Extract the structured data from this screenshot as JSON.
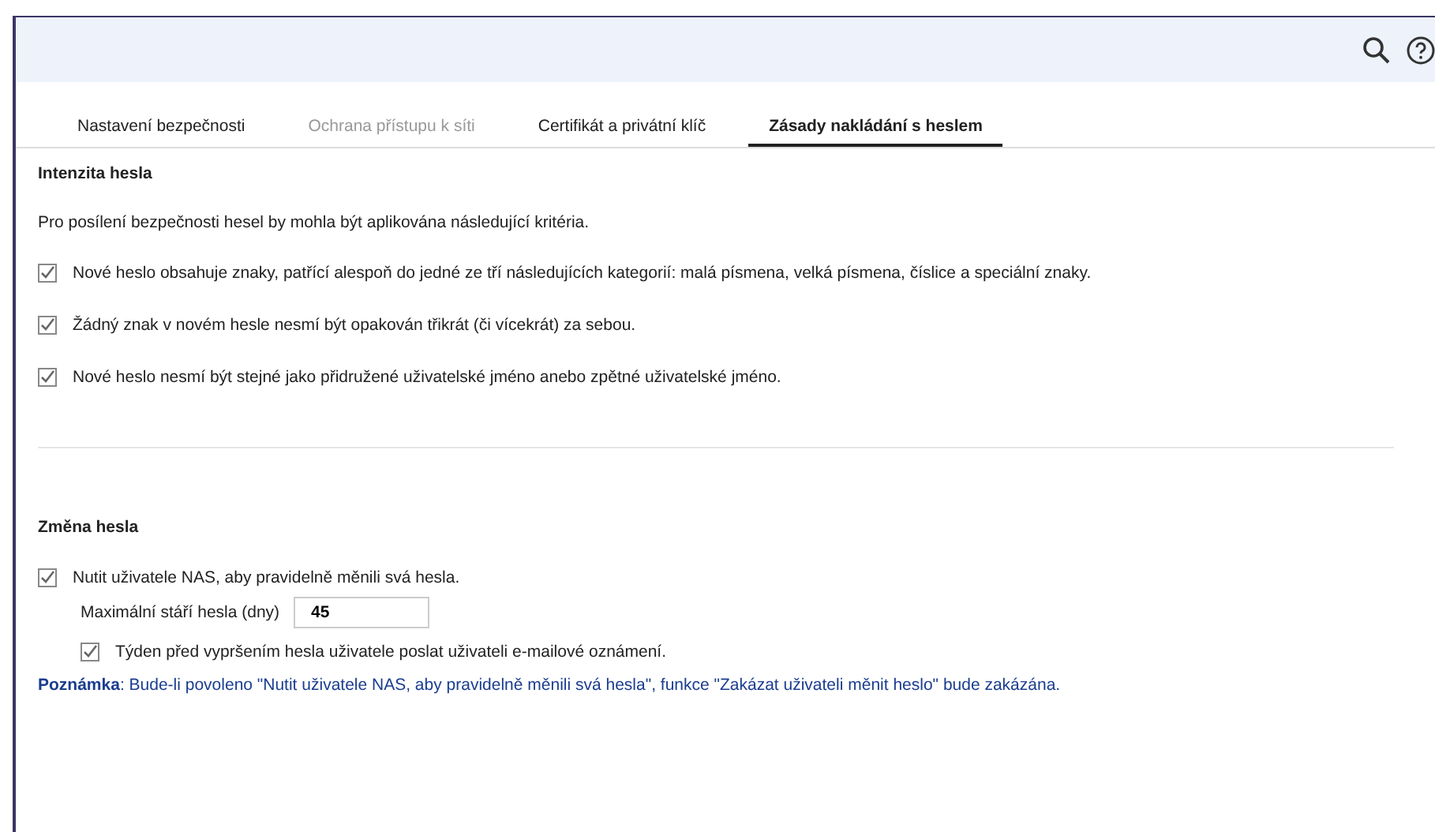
{
  "tabs": [
    {
      "label": "Nastavení bezpečnosti",
      "selected": false,
      "disabled": false
    },
    {
      "label": "Ochrana přístupu k síti",
      "selected": false,
      "disabled": true
    },
    {
      "label": "Certifikát a privátní klíč",
      "selected": false,
      "disabled": false
    },
    {
      "label": "Zásady nakládání s heslem",
      "selected": true,
      "disabled": false
    }
  ],
  "strength": {
    "title": "Intenzita hesla",
    "intro": "Pro posílení bezpečnosti hesel by mohla být aplikována následující kritéria.",
    "options": [
      {
        "label": "Nové heslo obsahuje znaky, patřící alespoň do jedné ze tří následujících kategorií: malá písmena, velká písmena, číslice a speciální znaky.",
        "checked": true
      },
      {
        "label": "Žádný znak v novém hesle nesmí být opakován třikrát (či vícekrát) za sebou.",
        "checked": true
      },
      {
        "label": "Nové heslo nesmí být stejné jako přidružené uživatelské jméno anebo zpětné uživatelské jméno.",
        "checked": true
      }
    ]
  },
  "change": {
    "title": "Změna hesla",
    "force": {
      "label": "Nutit uživatele NAS, aby pravidelně měnili svá hesla.",
      "checked": true
    },
    "max_age": {
      "label": "Maximální stáří hesla (dny)",
      "value": "45"
    },
    "notify": {
      "label": "Týden před vypršením hesla uživatele poslat uživateli e-mailové oznámení.",
      "checked": true
    },
    "note": "**Poznámka**: Bude-li povoleno \"Nutit uživatele NAS, aby pravidelně měnili svá hesla\", funkce \"Zakázat uživateli měnit heslo\" bude zakázána."
  }
}
